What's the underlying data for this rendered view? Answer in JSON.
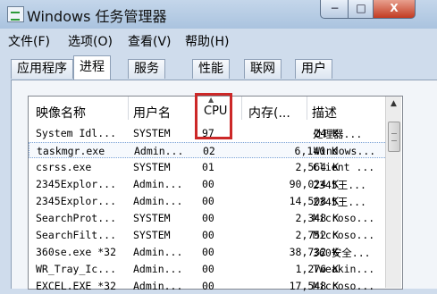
{
  "window": {
    "title": "Windows 任务管理器"
  },
  "window_buttons": {
    "minimize": "−",
    "maximize": "□",
    "close": "X"
  },
  "menu": [
    "文件(F)",
    "选项(O)",
    "查看(V)",
    "帮助(H)"
  ],
  "tabs": [
    "应用程序",
    "进程",
    "服务",
    "性能",
    "联网",
    "用户"
  ],
  "active_tab": "进程",
  "columns": {
    "name": "映像名称",
    "user": "用户名",
    "cpu": "CPU",
    "memory": "内存(...",
    "description": "描述"
  },
  "sort_indicator": "▲",
  "scroll_up": "▲",
  "highlight_color": "#cc2828",
  "processes": [
    {
      "name": "System Idl...",
      "user": "SYSTEM",
      "cpu": "97",
      "memory": "24 K",
      "description": "处理器..."
    },
    {
      "name": "taskmgr.exe",
      "user": "Admin...",
      "cpu": "02",
      "memory": "6,140 K",
      "description": "Windows..."
    },
    {
      "name": "csrss.exe",
      "user": "SYSTEM",
      "cpu": "01",
      "memory": "2,564 K",
      "description": "Client ..."
    },
    {
      "name": "2345Explor...",
      "user": "Admin...",
      "cpu": "00",
      "memory": "90,024 K",
      "description": "2345王..."
    },
    {
      "name": "2345Explor...",
      "user": "Admin...",
      "cpu": "00",
      "memory": "14,508 K",
      "description": "2345王..."
    },
    {
      "name": "SearchProt...",
      "user": "SYSTEM",
      "cpu": "00",
      "memory": "2,348 K",
      "description": "Microso..."
    },
    {
      "name": "SearchFilt...",
      "user": "SYSTEM",
      "cpu": "00",
      "memory": "2,752 K",
      "description": "Microso..."
    },
    {
      "name": "360se.exe *32",
      "user": "Admin...",
      "cpu": "00",
      "memory": "38,732 K",
      "description": "360安全..."
    },
    {
      "name": "WR_Tray_Ic...",
      "user": "Admin...",
      "cpu": "00",
      "memory": "1,276 K",
      "description": "Tweakin..."
    },
    {
      "name": "EXCEL.EXE *32",
      "user": "Admin...",
      "cpu": "00",
      "memory": "17,548 K",
      "description": "Microso..."
    }
  ]
}
